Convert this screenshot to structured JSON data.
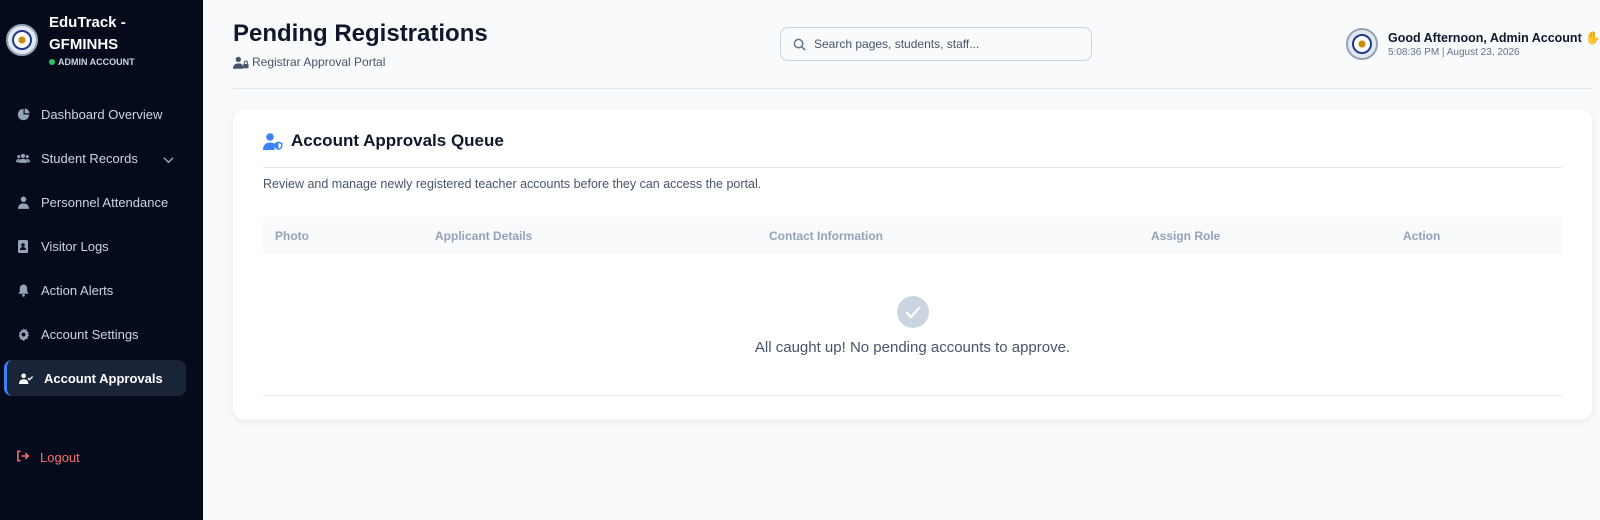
{
  "sidebar": {
    "brand_title": "EduTrack - GFMINHS",
    "brand_role": "ADMIN ACCOUNT",
    "items": [
      {
        "label": "Dashboard Overview",
        "icon": "pie-chart-icon"
      },
      {
        "label": "Student Records",
        "icon": "users-icon"
      },
      {
        "label": "Personnel Attendance",
        "icon": "user-icon"
      },
      {
        "label": "Visitor Logs",
        "icon": "address-book-icon"
      },
      {
        "label": "Action Alerts",
        "icon": "bell-icon"
      },
      {
        "label": "Account Settings",
        "icon": "gear-icon"
      },
      {
        "label": "Account Approvals",
        "icon": "user-check-icon"
      }
    ],
    "active_item": "Account Approvals",
    "logout_label": "Logout"
  },
  "header": {
    "title": "Pending Registrations",
    "subtitle": "Registrar Approval Portal",
    "search_placeholder": "Search pages, students, staff...",
    "greeting": "Good Afternoon, Admin Account",
    "timestamp": "5:08:36 PM | August 23, 2026"
  },
  "card": {
    "title": "Account Approvals Queue",
    "description": "Review and manage newly registered teacher accounts before they can access the portal.",
    "columns": [
      "Photo",
      "Applicant Details",
      "Contact Information",
      "Assign Role",
      "Action"
    ],
    "rows": [],
    "empty_message": "All caught up! No pending accounts to approve."
  },
  "colors": {
    "sidebar_bg": "#050b1a",
    "accent": "#3b82f6",
    "status_dot": "#22c55e",
    "logout": "#f87171",
    "page_bg": "#f8fafc"
  }
}
